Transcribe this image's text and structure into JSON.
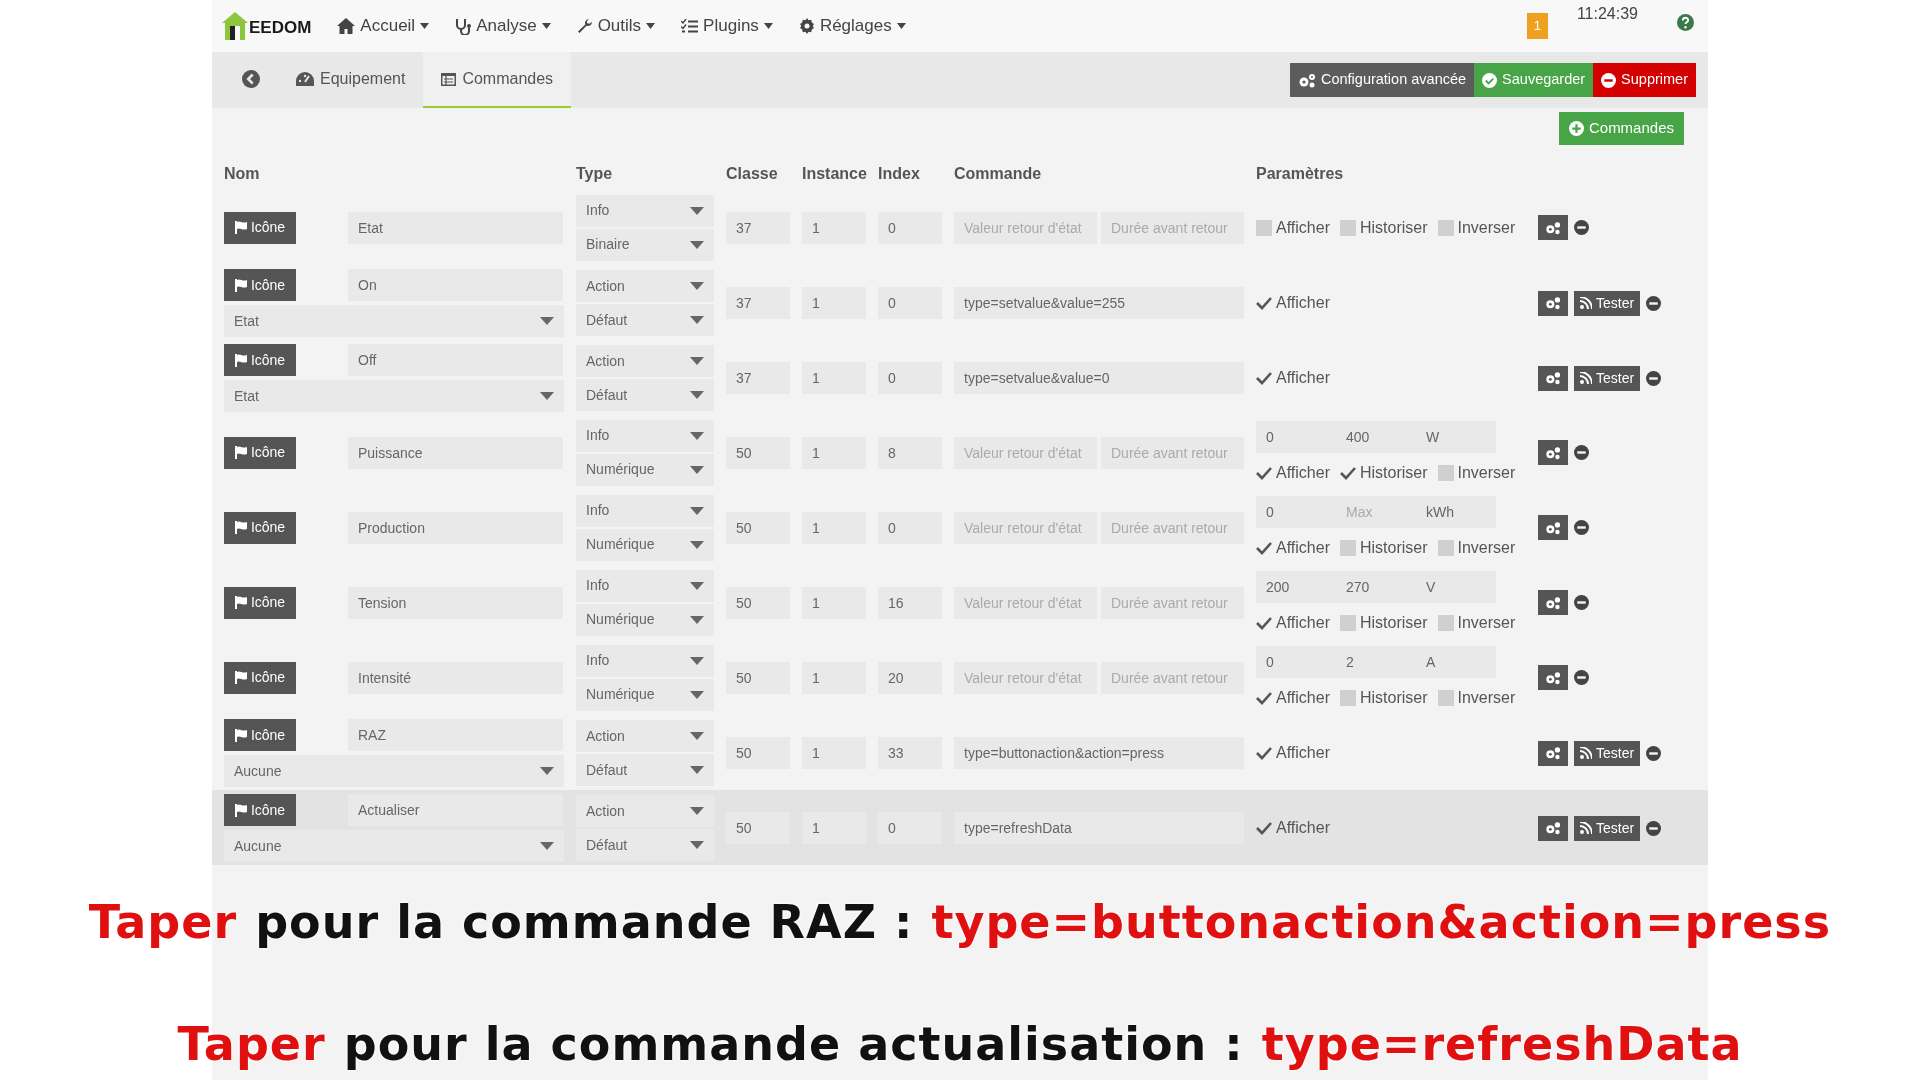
{
  "navbar": {
    "logo": "EEDOM",
    "menus": [
      {
        "label": "Accueil"
      },
      {
        "label": "Analyse"
      },
      {
        "label": "Outils"
      },
      {
        "label": "Plugins"
      },
      {
        "label": "Réglages"
      }
    ],
    "notification_count": "1",
    "time": "11:24:39"
  },
  "tabs": [
    {
      "label": "Equipement",
      "selected": false
    },
    {
      "label": "Commandes",
      "selected": true
    }
  ],
  "actions": [
    {
      "label": "Configuration avancée",
      "kind": "config"
    },
    {
      "label": "Sauvegarder",
      "kind": "save"
    },
    {
      "label": "Supprimer",
      "kind": "delete"
    }
  ],
  "add_button": "Commandes",
  "columns": [
    "Nom",
    "Type",
    "Classe",
    "Instance",
    "Index",
    "Commande",
    "Paramètres"
  ],
  "rows": [
    {
      "kind": "info",
      "icon_button": "Icône",
      "name": "Etat",
      "type": "Info",
      "subtype": "Binaire",
      "classe": "37",
      "instance": "1",
      "index": "0",
      "command": [
        {
          "placeholder": "Valeur retour d'état"
        },
        {
          "placeholder": "Durée avant retour"
        }
      ],
      "checkboxes": [
        {
          "label": "Afficher",
          "checked": false
        },
        {
          "label": "Historiser",
          "checked": false
        },
        {
          "label": "Inverser",
          "checked": false
        }
      ],
      "highlighted": false
    },
    {
      "kind": "action",
      "icon_button": "Icône",
      "name": "On",
      "value_link": "Etat",
      "type": "Action",
      "subtype": "Défaut",
      "classe": "37",
      "instance": "1",
      "index": "0",
      "command": [
        {
          "value": "type=setvalue&value=255"
        }
      ],
      "checkboxes": [
        {
          "label": "Afficher",
          "checked": true
        }
      ],
      "tester": "Tester",
      "highlighted": false
    },
    {
      "kind": "action",
      "icon_button": "Icône",
      "name": "Off",
      "value_link": "Etat",
      "type": "Action",
      "subtype": "Défaut",
      "classe": "37",
      "instance": "1",
      "index": "0",
      "command": [
        {
          "value": "type=setvalue&value=0"
        }
      ],
      "checkboxes": [
        {
          "label": "Afficher",
          "checked": true
        }
      ],
      "tester": "Tester",
      "highlighted": false
    },
    {
      "kind": "info",
      "icon_button": "Icône",
      "name": "Puissance",
      "type": "Info",
      "subtype": "Numérique",
      "classe": "50",
      "instance": "1",
      "index": "8",
      "command": [
        {
          "placeholder": "Valeur retour d'état"
        },
        {
          "placeholder": "Durée avant retour"
        }
      ],
      "range": [
        {
          "value": "0"
        },
        {
          "value": "400"
        },
        {
          "value": "W"
        }
      ],
      "checkboxes": [
        {
          "label": "Afficher",
          "checked": true
        },
        {
          "label": "Historiser",
          "checked": true
        },
        {
          "label": "Inverser",
          "checked": false
        }
      ],
      "highlighted": false
    },
    {
      "kind": "info",
      "icon_button": "Icône",
      "name": "Production",
      "type": "Info",
      "subtype": "Numérique",
      "classe": "50",
      "instance": "1",
      "index": "0",
      "command": [
        {
          "placeholder": "Valeur retour d'état"
        },
        {
          "placeholder": "Durée avant retour"
        }
      ],
      "range": [
        {
          "value": "0"
        },
        {
          "placeholder": "Max"
        },
        {
          "value": "kWh"
        }
      ],
      "checkboxes": [
        {
          "label": "Afficher",
          "checked": true
        },
        {
          "label": "Historiser",
          "checked": false
        },
        {
          "label": "Inverser",
          "checked": false
        }
      ],
      "highlighted": false
    },
    {
      "kind": "info",
      "icon_button": "Icône",
      "name": "Tension",
      "type": "Info",
      "subtype": "Numérique",
      "classe": "50",
      "instance": "1",
      "index": "16",
      "command": [
        {
          "placeholder": "Valeur retour d'état"
        },
        {
          "placeholder": "Durée avant retour"
        }
      ],
      "range": [
        {
          "value": "200"
        },
        {
          "value": "270"
        },
        {
          "value": "V"
        }
      ],
      "checkboxes": [
        {
          "label": "Afficher",
          "checked": true
        },
        {
          "label": "Historiser",
          "checked": false
        },
        {
          "label": "Inverser",
          "checked": false
        }
      ],
      "highlighted": false
    },
    {
      "kind": "info",
      "icon_button": "Icône",
      "name": "Intensité",
      "type": "Info",
      "subtype": "Numérique",
      "classe": "50",
      "instance": "1",
      "index": "20",
      "command": [
        {
          "placeholder": "Valeur retour d'état"
        },
        {
          "placeholder": "Durée avant retour"
        }
      ],
      "range": [
        {
          "value": "0"
        },
        {
          "value": "2"
        },
        {
          "value": "A"
        }
      ],
      "checkboxes": [
        {
          "label": "Afficher",
          "checked": true
        },
        {
          "label": "Historiser",
          "checked": false
        },
        {
          "label": "Inverser",
          "checked": false
        }
      ],
      "highlighted": false
    },
    {
      "kind": "action",
      "icon_button": "Icône",
      "name": "RAZ",
      "value_link": "Aucune",
      "type": "Action",
      "subtype": "Défaut",
      "classe": "50",
      "instance": "1",
      "index": "33",
      "command": [
        {
          "value": "type=buttonaction&action=press"
        }
      ],
      "checkboxes": [
        {
          "label": "Afficher",
          "checked": true
        }
      ],
      "tester": "Tester",
      "highlighted": false
    },
    {
      "kind": "action",
      "icon_button": "Icône",
      "name": "Actualiser",
      "value_link": "Aucune",
      "type": "Action",
      "subtype": "Défaut",
      "classe": "50",
      "instance": "1",
      "index": "0",
      "command": [
        {
          "value": "type=refreshData"
        }
      ],
      "checkboxes": [
        {
          "label": "Afficher",
          "checked": true
        }
      ],
      "tester": "Tester",
      "highlighted": true
    }
  ],
  "captions": [
    {
      "parts": [
        {
          "text": "Taper",
          "kind": "accent"
        },
        {
          "text": "pour la  commande  RAZ :",
          "kind": "plain"
        },
        {
          "text": "type=buttonaction&action=press",
          "kind": "accent"
        }
      ]
    },
    {
      "parts": [
        {
          "text": "Taper",
          "kind": "accent"
        },
        {
          "text": "pour la  commande  actualisation :",
          "kind": "plain"
        },
        {
          "text": "type=refreshData",
          "kind": "accent"
        }
      ]
    }
  ]
}
